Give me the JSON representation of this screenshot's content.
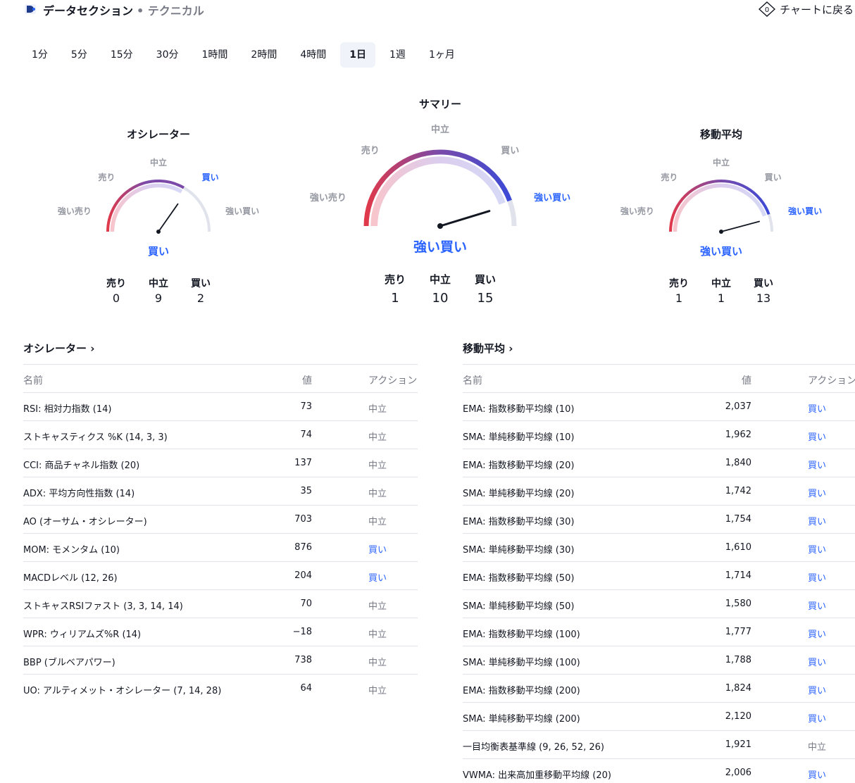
{
  "header": {
    "title": "データセクション",
    "subtitle": "• テクニカル",
    "back_label": "チャートに戻る"
  },
  "timeframes": [
    "1分",
    "5分",
    "15分",
    "30分",
    "1時間",
    "2時間",
    "4時間",
    "1日",
    "1週",
    "1ヶ月"
  ],
  "active_timeframe": "1日",
  "labels": {
    "strong_sell": "強い売り",
    "sell": "売り",
    "neutral": "中立",
    "buy": "買い",
    "strong_buy": "強い買い"
  },
  "colors": {
    "sell": "#e0394a",
    "mid": "#7b4aa8",
    "buy": "#3d4ad6",
    "accent": "#2962ff"
  },
  "gauges": {
    "oscillators": {
      "title": "オシレーター",
      "verdict": "買い",
      "sell": "0",
      "neutral": "9",
      "buy": "2"
    },
    "summary": {
      "title": "サマリー",
      "verdict": "強い買い",
      "sell": "1",
      "neutral": "10",
      "buy": "15"
    },
    "moving_averages": {
      "title": "移動平均",
      "verdict": "強い買い",
      "sell": "1",
      "neutral": "1",
      "buy": "13"
    }
  },
  "oscillators_table": {
    "title": "オシレーター ›",
    "columns": [
      "名前",
      "値",
      "アクション"
    ],
    "rows": [
      {
        "name": "RSI: 相対力指数 (14)",
        "value": "73",
        "action": "中立"
      },
      {
        "name": "ストキャスティクス %K (14, 3, 3)",
        "value": "74",
        "action": "中立"
      },
      {
        "name": "CCI: 商品チャネル指数 (20)",
        "value": "137",
        "action": "中立"
      },
      {
        "name": "ADX: 平均方向性指数 (14)",
        "value": "35",
        "action": "中立"
      },
      {
        "name": "AO (オーサム・オシレーター)",
        "value": "703",
        "action": "中立"
      },
      {
        "name": "MOM: モメンタム (10)",
        "value": "876",
        "action": "買い"
      },
      {
        "name": "MACDレベル (12, 26)",
        "value": "204",
        "action": "買い"
      },
      {
        "name": "ストキャスRSIファスト (3, 3, 14, 14)",
        "value": "70",
        "action": "中立"
      },
      {
        "name": "WPR: ウィリアムズ%R (14)",
        "value": "−18",
        "action": "中立"
      },
      {
        "name": "BBP (ブルベアパワー)",
        "value": "738",
        "action": "中立"
      },
      {
        "name": "UO: アルティメット・オシレーター (7, 14, 28)",
        "value": "64",
        "action": "中立"
      }
    ]
  },
  "ma_table": {
    "title": "移動平均 ›",
    "columns": [
      "名前",
      "値",
      "アクション"
    ],
    "rows": [
      {
        "name": "EMA: 指数移動平均線 (10)",
        "value": "2,037",
        "action": "買い"
      },
      {
        "name": "SMA: 単純移動平均線 (10)",
        "value": "1,962",
        "action": "買い"
      },
      {
        "name": "EMA: 指数移動平均線 (20)",
        "value": "1,840",
        "action": "買い"
      },
      {
        "name": "SMA: 単純移動平均線 (20)",
        "value": "1,742",
        "action": "買い"
      },
      {
        "name": "EMA: 指数移動平均線 (30)",
        "value": "1,754",
        "action": "買い"
      },
      {
        "name": "SMA: 単純移動平均線 (30)",
        "value": "1,610",
        "action": "買い"
      },
      {
        "name": "EMA: 指数移動平均線 (50)",
        "value": "1,714",
        "action": "買い"
      },
      {
        "name": "SMA: 単純移動平均線 (50)",
        "value": "1,580",
        "action": "買い"
      },
      {
        "name": "EMA: 指数移動平均線 (100)",
        "value": "1,777",
        "action": "買い"
      },
      {
        "name": "SMA: 単純移動平均線 (100)",
        "value": "1,788",
        "action": "買い"
      },
      {
        "name": "EMA: 指数移動平均線 (200)",
        "value": "1,824",
        "action": "買い"
      },
      {
        "name": "SMA: 単純移動平均線 (200)",
        "value": "2,120",
        "action": "買い"
      },
      {
        "name": "一目均衡表基準線 (9, 26, 52, 26)",
        "value": "1,921",
        "action": "中立"
      },
      {
        "name": "VWMA: 出来高加重移動平均線 (20)",
        "value": "2,006",
        "action": "買い"
      }
    ]
  }
}
